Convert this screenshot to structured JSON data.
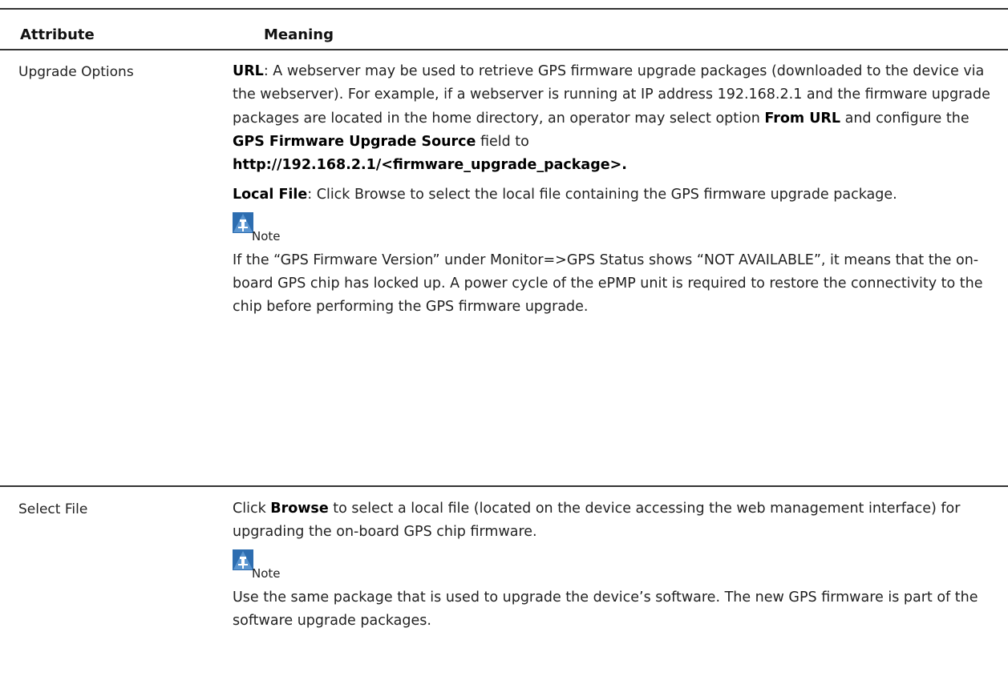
{
  "table": {
    "headers": {
      "attribute": "Attribute",
      "meaning": "Meaning"
    },
    "rows": [
      {
        "attribute": "Upgrade Options",
        "url_term": "URL",
        "url_text": ": A webserver may be used to retrieve GPS firmware upgrade packages (downloaded to the device via the webserver). For example, if a webserver is running at IP address 192.168.2.1 and the firmware upgrade packages are located in the home directory, an operator may select option ",
        "from_url": "From URL",
        "and_text": " and configure the ",
        "source_field": "GPS Firmware Upgrade Source",
        "field_to": " field to",
        "example_url": "http://192.168.2.1/<firmware_upgrade_package>.",
        "local_term": "Local File",
        "local_text": ": Click Browse to select the local file containing the GPS firmware upgrade package.",
        "note_label": "Note",
        "note_text": "If the “GPS Firmware Version” under Monitor=>GPS Status shows “NOT AVAILABLE”, it means that the on-board GPS chip has locked up. A power cycle of the ePMP unit is required to restore the connectivity to the chip before performing the GPS firmware upgrade."
      },
      {
        "attribute": "Select File",
        "click_text": "Click ",
        "browse_term": "Browse",
        "browse_text": " to select a local file (located on the device accessing the web management interface) for upgrading the on-board GPS chip firmware.",
        "note_label": "Note",
        "note_text": "Use the same package that is used to upgrade the device’s software. The new GPS firmware is part of the software upgrade packages."
      }
    ]
  },
  "icons": {
    "note": "note-pin-icon",
    "note_color": "#2d6db0"
  }
}
